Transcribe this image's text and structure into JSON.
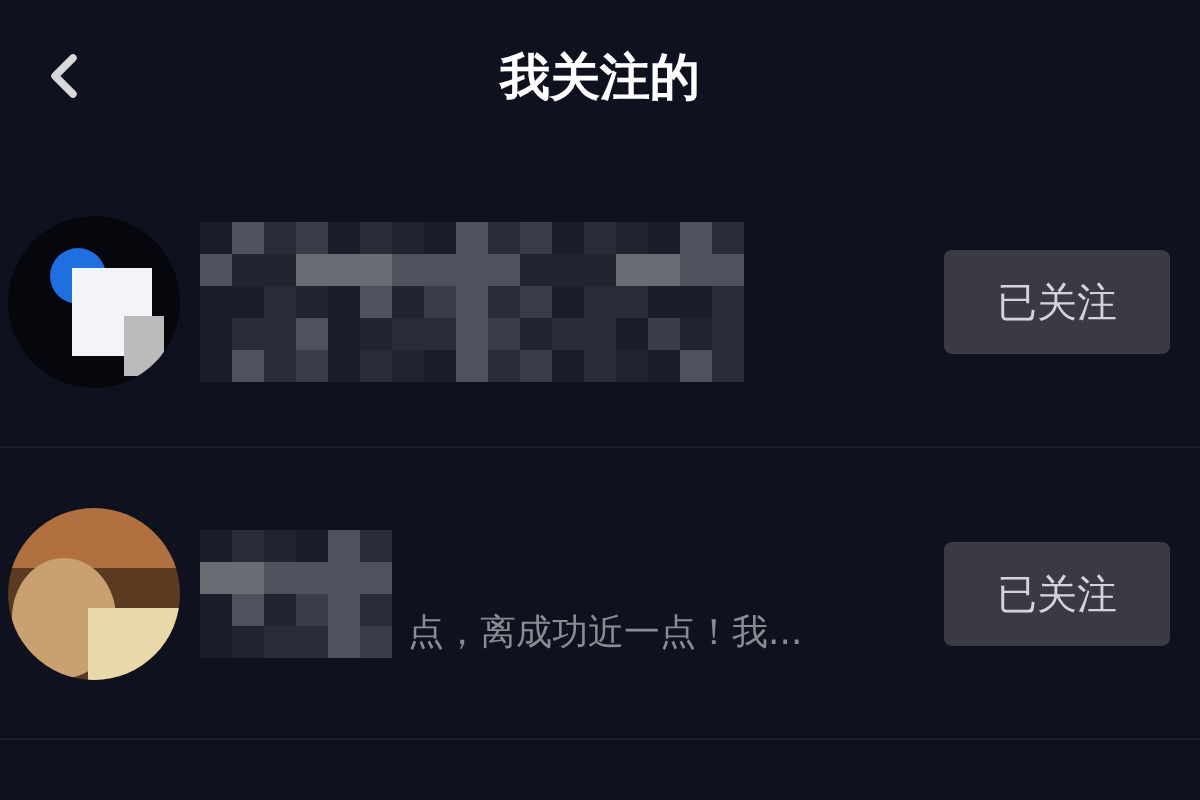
{
  "header": {
    "title": "我关注的"
  },
  "users": [
    {
      "button": "已关注"
    },
    {
      "bio": "点，离成功近一点！我...",
      "button": "已关注"
    }
  ]
}
